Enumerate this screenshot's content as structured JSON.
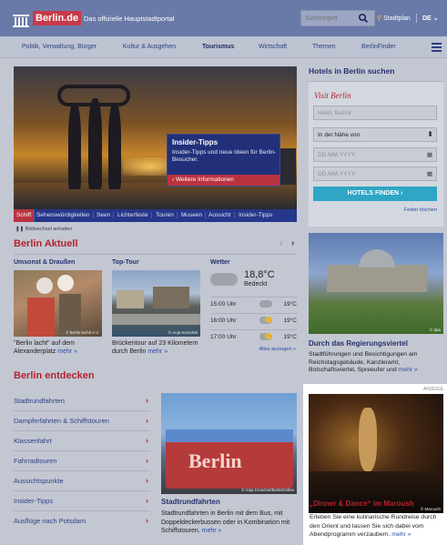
{
  "header": {
    "logo_text": "Berlin.de",
    "tagline": "Das offizielle Hauptstadtportal",
    "search_placeholder": "Suchbegriff",
    "stadtplan": "Stadtplan",
    "lang": "DE"
  },
  "nav": [
    "Politik, Verwaltung, Bürger",
    "Kultur & Ausgehen",
    "Tourismus",
    "Wirtschaft",
    "Themen",
    "BerlinFinder"
  ],
  "hero": {
    "overlay_title": "Insider-Tipps",
    "overlay_text": "Insider-Tipps und neue Ideen für Berlin-Besucher.",
    "overlay_link": "Weitere Informationen",
    "tabs": [
      "Schiff",
      "Sehenswürdigkeiten",
      "Seen",
      "Lichterfeste",
      "Touren",
      "Museen",
      "Aussicht",
      "Insider-Tipps"
    ],
    "bildwechsel": "Bildwechsel anhalten"
  },
  "aktuell": {
    "heading": "Berlin Aktuell",
    "col1": {
      "title": "Umsonst & Draußen",
      "credit": "© Berlin lacht! e.V.",
      "text": "\"Berlin lacht\" auf dem Alexanderplatz",
      "more": "mehr »"
    },
    "col2": {
      "title": "Top-Tour",
      "credit": "© Anja Kroschel",
      "text": "Brückentour auf 23 Kilometern durch Berlin",
      "more": "mehr »"
    },
    "weather": {
      "title": "Wetter",
      "temp": "18,8°C",
      "condition": "Bedeckt",
      "rows": [
        {
          "time": "15:00 Uhr",
          "temp": "19°C"
        },
        {
          "time": "16:00 Uhr",
          "temp": "19°C"
        },
        {
          "time": "17:00 Uhr",
          "temp": "19°C"
        }
      ],
      "more": "Alles anzeigen »"
    }
  },
  "hotels": {
    "heading": "Hotels in Berlin suchen",
    "brand": "Visit Berlin",
    "field_placeholder": "Hotel, Bezirk",
    "near": "In der Nähe von",
    "date_placeholder": "DD.MM.YYYY",
    "button": "HOTELS FINDEN",
    "link": "Felder löschen"
  },
  "regierung": {
    "credit": "© dpa",
    "title": "Durch das Regierungsviertel",
    "text": "Stadtführungen und Besichtigungen am Reichstagsgebäude, Kanzleramt, Botschaftsviertel, Spreeufer und",
    "more": "mehr »"
  },
  "entdecken": {
    "heading": "Berlin entdecken",
    "links": [
      "Stadtrundfahrten",
      "Dampferfahrten & Schiffstouren",
      "Klassenfahrt",
      "Fahrradtouren",
      "Aussichtspunkte",
      "Insider-Tipps",
      "Ausflüge nach Potsdam"
    ],
    "feature": {
      "bus_text": "Berlin",
      "credit": "© Anja Kroschel/BerlinOnline",
      "title": "Stadtrundfahrten",
      "text": "Stadtrundfahrten in Berlin mit dem Bus, mit Doppeldeckerbussen oder in Kombination mit Schiffstouren.",
      "more": "mehr »"
    }
  },
  "ad": {
    "label": "ANZEIGE",
    "credit": "© Maroush",
    "title": "„Dinner & Dance“ im Maroush",
    "text": "Erleben Sie eine kulinarische Rundreise durch den Orient und lassen Sie sich dabei vom Abendprogramm verzaubern.",
    "more": "mehr »"
  }
}
